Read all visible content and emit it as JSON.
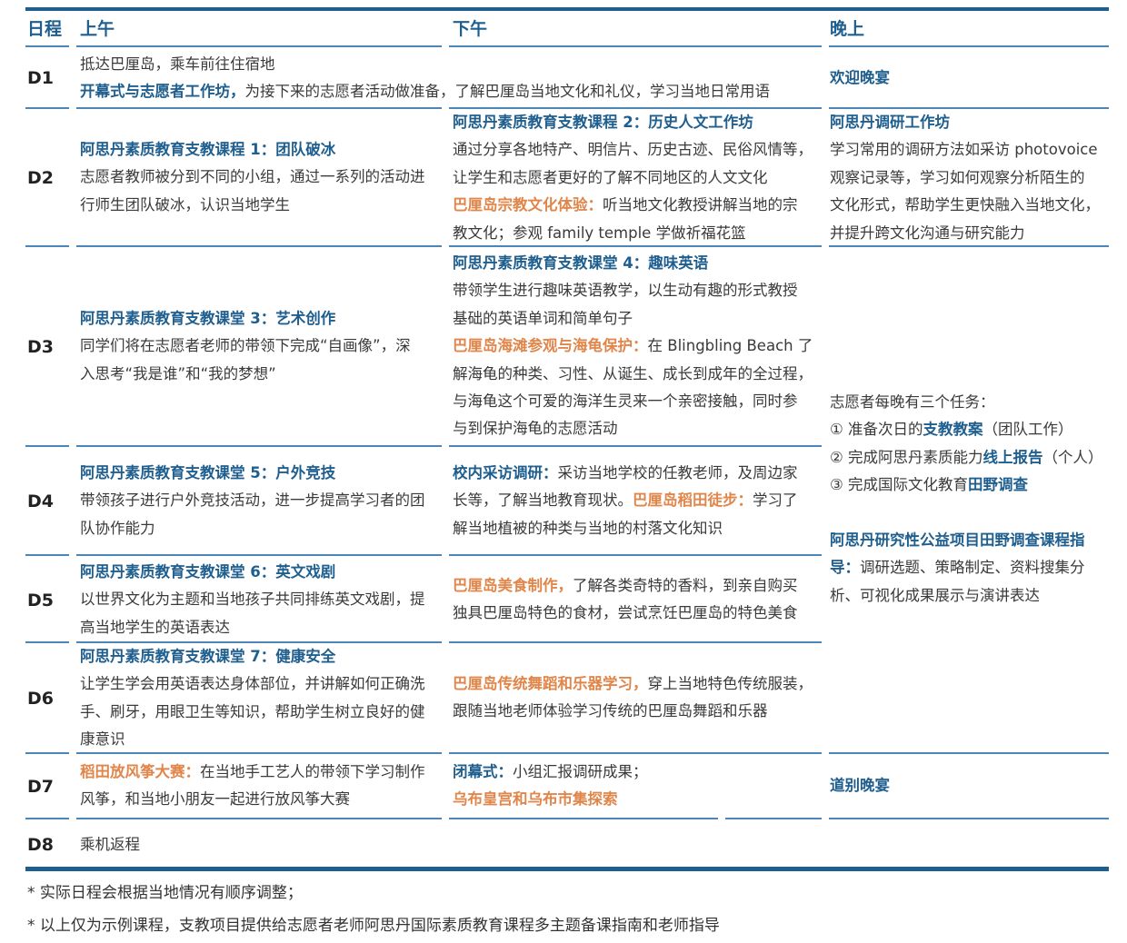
{
  "header": {
    "col_day": "日程",
    "col_am": "上午",
    "col_pm": "下午",
    "col_eve": "晚上"
  },
  "rows": {
    "d1": {
      "day": "D1",
      "am_line1": "抵达巴厘岛，乘车前往住宿地",
      "am_line2_hl": "开幕式与志愿者工作坊，",
      "am_line2_rest": "为接下来的志愿者活动做准备，了解巴厘岛当地文化和礼仪，学习当地日常用语",
      "eve": "欢迎晚宴"
    },
    "d2": {
      "day": "D2",
      "am_title": "阿思丹素质教育支教课程 1：团队破冰",
      "am_l1": "志愿者教师被分到不同的小组，通过一系列的活动进",
      "am_l2": "行师生团队破冰，认识当地学生",
      "pm_title": "阿思丹素质教育支教课程 2：历史人文工作坊",
      "pm_l1": "通过分享各地特产、明信片、历史古迹、民俗风情等，",
      "pm_l2": "让学生和志愿者更好的了解不同地区的人文文化",
      "pm_hl": "巴厘岛宗教文化体验：",
      "pm_l3_rest": "听当地文化教授讲解当地的宗",
      "pm_l4": "教文化；参观 family temple 学做祈福花篮",
      "eve_title": "阿思丹调研工作坊",
      "eve_l1": "学习常用的调研方法如采访 photovoice",
      "eve_l2": "观察记录等，学习如何观察分析陌生的",
      "eve_l3": "文化形式，帮助学生更快融入当地文化，",
      "eve_l4": "并提升跨文化沟通与研究能力"
    },
    "d3": {
      "day": "D3",
      "am_title": "阿思丹素质教育支教课堂 3：艺术创作",
      "am_l1": "同学们将在志愿者老师的带领下完成“自画像”，深",
      "am_l2": "入思考“我是谁”和“我的梦想”",
      "pm_title": "阿思丹素质教育支教课堂 4：趣味英语",
      "pm_l1": "带领学生进行趣味英语教学，以生动有趣的形式教授",
      "pm_l2": "基础的英语单词和简单句子",
      "pm_hl": "巴厘岛海滩参观与海龟保护：",
      "pm_l3_rest": "在 Blingbling Beach 了",
      "pm_l4": "解海龟的种类、习性、从诞生、成长到成年的全过程，",
      "pm_l5": "与海龟这个可爱的海洋生灵来一个亲密接触，同时参",
      "pm_l6": "与到保护海龟的志愿活动"
    },
    "d4": {
      "day": "D4",
      "am_title": "阿思丹素质教育支教课堂 5：户外竞技",
      "am_l1": "带领孩子进行户外竞技活动，进一步提高学习者的团",
      "am_l2": "队协作能力",
      "pm_hl1": "校内采访调研：",
      "pm_l1_rest": "采访当地学校的任教老师，及周边家",
      "pm_l2_a": "长等，了解当地教育现状。",
      "pm_hl2": "巴厘岛稻田徒步：",
      "pm_l2_b": "学习了",
      "pm_l3": "解当地植被的种类与当地的村落文化知识"
    },
    "d5": {
      "day": "D5",
      "am_title": "阿思丹素质教育支教课堂 6：英文戏剧",
      "am_l1": "以世界文化为主题和当地孩子共同排练英文戏剧，提",
      "am_l2": "高当地学生的英语表达",
      "pm_hl": "巴厘岛美食制作，",
      "pm_l1_rest": "了解各类奇特的香料，到亲自购买",
      "pm_l2": "独具巴厘岛特色的食材，尝试烹饪巴厘岛的特色美食"
    },
    "d6": {
      "day": "D6",
      "am_title": "阿思丹素质教育支教课堂 7：健康安全",
      "am_l1": "让学生学会用英语表达身体部位，并讲解如何正确洗",
      "am_l2": "手、刷牙，用眼卫生等知识，帮助学生树立良好的健",
      "am_l3": "康意识",
      "pm_hl": "巴厘岛传统舞蹈和乐器学习，",
      "pm_l1_rest": "穿上当地特色传统服装，",
      "pm_l2": "跟随当地老师体验学习传统的巴厘岛舞蹈和乐器"
    },
    "d7": {
      "day": "D7",
      "am_hl": "稻田放风筝大赛：",
      "am_l1_rest": "在当地手工艺人的带领下学习制作",
      "am_l2": "风筝，和当地小朋友一起进行放风筝大赛",
      "pm_hl": "闭幕式：",
      "pm_l1_rest": "小组汇报调研成果；",
      "pm_l2": "乌布皇宫和乌布市集探索",
      "eve": "道别晚宴"
    },
    "d8": {
      "day": "D8",
      "am": "乘机返程"
    }
  },
  "evening_block": {
    "intro": "志愿者每晚有三个任务：",
    "t1_a": "① 准备次日的",
    "t1_hl": "支教教案",
    "t1_b": "（团队工作）",
    "t2_a": "② 完成阿思丹素质能力",
    "t2_hl": "线上报告",
    "t2_b": "（个人）",
    "t3_a": "③ 完成国际文化教育",
    "t3_hl": "田野调查",
    "guide_title1": "阿思丹研究性公益项目田野调查课程指",
    "guide_title2": "导：",
    "guide_l1_rest": "调研选题、策略制定、资料搜集分",
    "guide_l2": "析、可视化成果展示与演讲表达"
  },
  "notes": {
    "n1": "* 实际日程会根据当地情况有顺序调整；",
    "n2": "* 以上仅为示例课程，支教项目提供给志愿者老师阿思丹国际素质教育课程多主题备课指南和老师指导"
  },
  "colors": {
    "accent_blue": "#1f5f8f",
    "accent_orange": "#e0864a",
    "text": "#3a3a3a"
  }
}
